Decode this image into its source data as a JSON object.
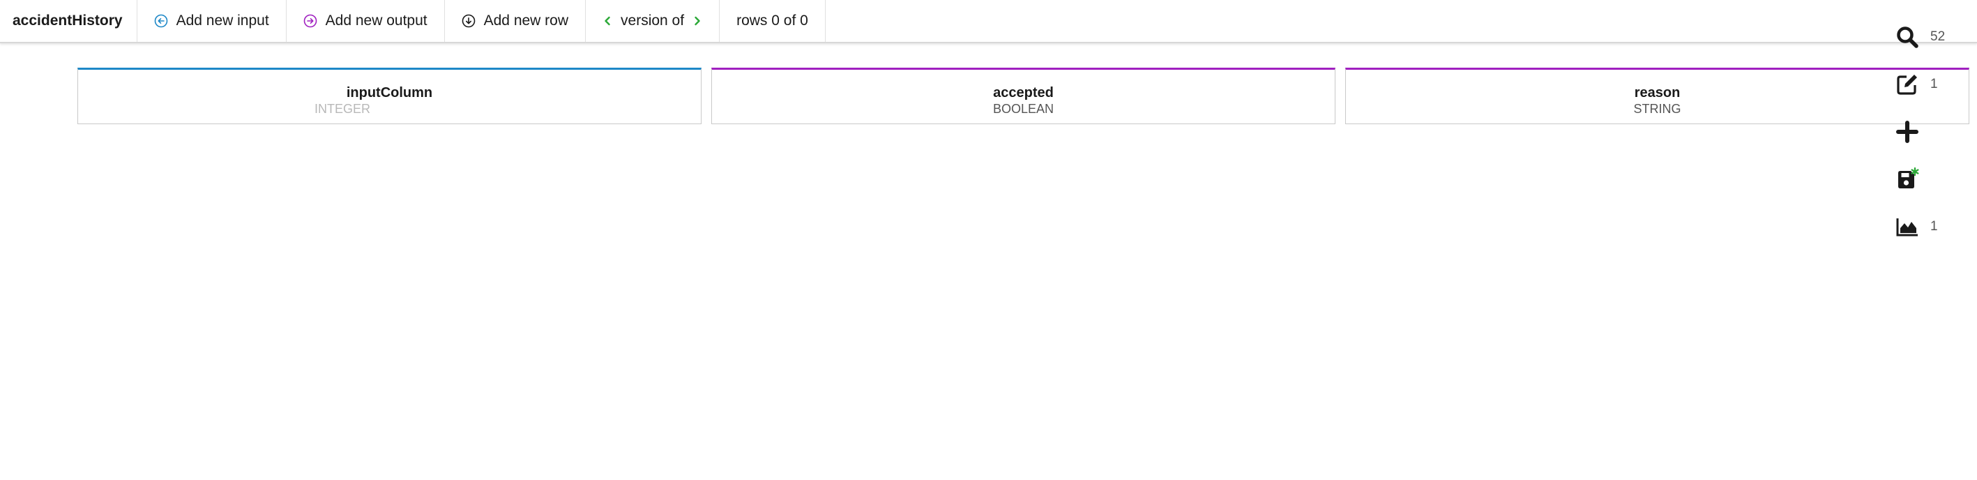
{
  "toolbar": {
    "title": "accidentHistory",
    "add_input_label": "Add new input",
    "add_output_label": "Add new output",
    "add_row_label": "Add new row",
    "version_label": "version of",
    "rows_label": "rows 0 of 0"
  },
  "columns": [
    {
      "name": "inputColumn",
      "type": "INTEGER",
      "kind": "input",
      "accent": "#1e88c7"
    },
    {
      "name": "accepted",
      "type": "BOOLEAN",
      "kind": "output",
      "accent": "#a020c0"
    },
    {
      "name": "reason",
      "type": "STRING",
      "kind": "output",
      "accent": "#a020c0"
    }
  ],
  "rail": {
    "search_count": "52",
    "edit_count": "1",
    "chart_count": "1"
  },
  "colors": {
    "input_accent": "#1e88c7",
    "output_accent": "#a020c0",
    "version_arrow": "#2aa836",
    "save_badge": "#2aa836",
    "icon_dark": "#1a1a1a"
  },
  "icons": {
    "add_input": "arrow-left-circle-icon",
    "add_output": "arrow-right-circle-icon",
    "add_row": "arrow-down-circle-icon",
    "version_prev": "chevron-left-icon",
    "version_next": "chevron-right-icon",
    "search": "search-icon",
    "edit": "edit-icon",
    "add": "plus-icon",
    "save": "save-icon",
    "chart": "area-chart-icon"
  }
}
